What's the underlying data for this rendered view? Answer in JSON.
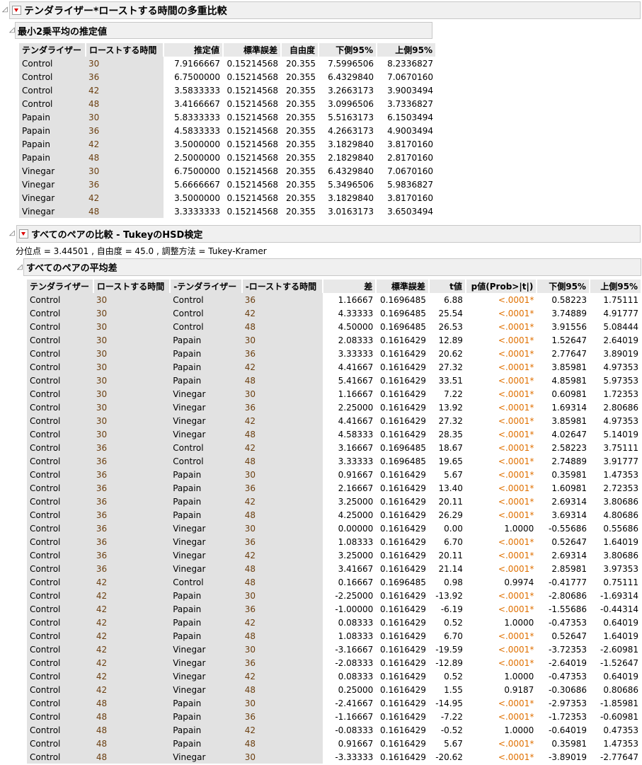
{
  "title": "テンダライザー*ローストする時間の多重比較",
  "lsmeans": {
    "title": "最小2乗平均の推定値",
    "headers": [
      "テンダライザー",
      "ローストする時間",
      "推定値",
      "標準誤差",
      "自由度",
      "下側95%",
      "上側95%"
    ],
    "rows": [
      [
        "Control",
        "30",
        "7.9166667",
        "0.15214568",
        "20.355",
        "7.5996506",
        "8.2336827"
      ],
      [
        "Control",
        "36",
        "6.7500000",
        "0.15214568",
        "20.355",
        "6.4329840",
        "7.0670160"
      ],
      [
        "Control",
        "42",
        "3.5833333",
        "0.15214568",
        "20.355",
        "3.2663173",
        "3.9003494"
      ],
      [
        "Control",
        "48",
        "3.4166667",
        "0.15214568",
        "20.355",
        "3.0996506",
        "3.7336827"
      ],
      [
        "Papain",
        "30",
        "5.8333333",
        "0.15214568",
        "20.355",
        "5.5163173",
        "6.1503494"
      ],
      [
        "Papain",
        "36",
        "4.5833333",
        "0.15214568",
        "20.355",
        "4.2663173",
        "4.9003494"
      ],
      [
        "Papain",
        "42",
        "3.5000000",
        "0.15214568",
        "20.355",
        "3.1829840",
        "3.8170160"
      ],
      [
        "Papain",
        "48",
        "2.5000000",
        "0.15214568",
        "20.355",
        "2.1829840",
        "2.8170160"
      ],
      [
        "Vinegar",
        "30",
        "6.7500000",
        "0.15214568",
        "20.355",
        "6.4329840",
        "7.0670160"
      ],
      [
        "Vinegar",
        "36",
        "5.6666667",
        "0.15214568",
        "20.355",
        "5.3496506",
        "5.9836827"
      ],
      [
        "Vinegar",
        "42",
        "3.5000000",
        "0.15214568",
        "20.355",
        "3.1829840",
        "3.8170160"
      ],
      [
        "Vinegar",
        "48",
        "3.3333333",
        "0.15214568",
        "20.355",
        "3.0163173",
        "3.6503494"
      ]
    ]
  },
  "tukey": {
    "title": "すべてのペアの比較 - TukeyのHSD検定",
    "note": "分位点 = 3.44501 , 自由度 = 45.0 , 調整方法 = Tukey-Kramer",
    "diff_title": "すべてのペアの平均差",
    "headers": [
      "テンダライザー",
      "ローストする時間",
      "-テンダライザー",
      "-ローストする時間",
      "差",
      "標準誤差",
      "t値",
      "p値(Prob>|t|)",
      "下側95%",
      "上側95%"
    ],
    "rows": [
      [
        "Control",
        "30",
        "Control",
        "36",
        "1.16667",
        "0.1696485",
        "6.88",
        "<.0001*",
        "0.58223",
        "1.75111"
      ],
      [
        "Control",
        "30",
        "Control",
        "42",
        "4.33333",
        "0.1696485",
        "25.54",
        "<.0001*",
        "3.74889",
        "4.91777"
      ],
      [
        "Control",
        "30",
        "Control",
        "48",
        "4.50000",
        "0.1696485",
        "26.53",
        "<.0001*",
        "3.91556",
        "5.08444"
      ],
      [
        "Control",
        "30",
        "Papain",
        "30",
        "2.08333",
        "0.1616429",
        "12.89",
        "<.0001*",
        "1.52647",
        "2.64019"
      ],
      [
        "Control",
        "30",
        "Papain",
        "36",
        "3.33333",
        "0.1616429",
        "20.62",
        "<.0001*",
        "2.77647",
        "3.89019"
      ],
      [
        "Control",
        "30",
        "Papain",
        "42",
        "4.41667",
        "0.1616429",
        "27.32",
        "<.0001*",
        "3.85981",
        "4.97353"
      ],
      [
        "Control",
        "30",
        "Papain",
        "48",
        "5.41667",
        "0.1616429",
        "33.51",
        "<.0001*",
        "4.85981",
        "5.97353"
      ],
      [
        "Control",
        "30",
        "Vinegar",
        "30",
        "1.16667",
        "0.1616429",
        "7.22",
        "<.0001*",
        "0.60981",
        "1.72353"
      ],
      [
        "Control",
        "30",
        "Vinegar",
        "36",
        "2.25000",
        "0.1616429",
        "13.92",
        "<.0001*",
        "1.69314",
        "2.80686"
      ],
      [
        "Control",
        "30",
        "Vinegar",
        "42",
        "4.41667",
        "0.1616429",
        "27.32",
        "<.0001*",
        "3.85981",
        "4.97353"
      ],
      [
        "Control",
        "30",
        "Vinegar",
        "48",
        "4.58333",
        "0.1616429",
        "28.35",
        "<.0001*",
        "4.02647",
        "5.14019"
      ],
      [
        "Control",
        "36",
        "Control",
        "42",
        "3.16667",
        "0.1696485",
        "18.67",
        "<.0001*",
        "2.58223",
        "3.75111"
      ],
      [
        "Control",
        "36",
        "Control",
        "48",
        "3.33333",
        "0.1696485",
        "19.65",
        "<.0001*",
        "2.74889",
        "3.91777"
      ],
      [
        "Control",
        "36",
        "Papain",
        "30",
        "0.91667",
        "0.1616429",
        "5.67",
        "<.0001*",
        "0.35981",
        "1.47353"
      ],
      [
        "Control",
        "36",
        "Papain",
        "36",
        "2.16667",
        "0.1616429",
        "13.40",
        "<.0001*",
        "1.60981",
        "2.72353"
      ],
      [
        "Control",
        "36",
        "Papain",
        "42",
        "3.25000",
        "0.1616429",
        "20.11",
        "<.0001*",
        "2.69314",
        "3.80686"
      ],
      [
        "Control",
        "36",
        "Papain",
        "48",
        "4.25000",
        "0.1616429",
        "26.29",
        "<.0001*",
        "3.69314",
        "4.80686"
      ],
      [
        "Control",
        "36",
        "Vinegar",
        "30",
        "0.00000",
        "0.1616429",
        "0.00",
        "1.0000",
        "-0.55686",
        "0.55686"
      ],
      [
        "Control",
        "36",
        "Vinegar",
        "36",
        "1.08333",
        "0.1616429",
        "6.70",
        "<.0001*",
        "0.52647",
        "1.64019"
      ],
      [
        "Control",
        "36",
        "Vinegar",
        "42",
        "3.25000",
        "0.1616429",
        "20.11",
        "<.0001*",
        "2.69314",
        "3.80686"
      ],
      [
        "Control",
        "36",
        "Vinegar",
        "48",
        "3.41667",
        "0.1616429",
        "21.14",
        "<.0001*",
        "2.85981",
        "3.97353"
      ],
      [
        "Control",
        "42",
        "Control",
        "48",
        "0.16667",
        "0.1696485",
        "0.98",
        "0.9974",
        "-0.41777",
        "0.75111"
      ],
      [
        "Control",
        "42",
        "Papain",
        "30",
        "-2.25000",
        "0.1616429",
        "-13.92",
        "<.0001*",
        "-2.80686",
        "-1.69314"
      ],
      [
        "Control",
        "42",
        "Papain",
        "36",
        "-1.00000",
        "0.1616429",
        "-6.19",
        "<.0001*",
        "-1.55686",
        "-0.44314"
      ],
      [
        "Control",
        "42",
        "Papain",
        "42",
        "0.08333",
        "0.1616429",
        "0.52",
        "1.0000",
        "-0.47353",
        "0.64019"
      ],
      [
        "Control",
        "42",
        "Papain",
        "48",
        "1.08333",
        "0.1616429",
        "6.70",
        "<.0001*",
        "0.52647",
        "1.64019"
      ],
      [
        "Control",
        "42",
        "Vinegar",
        "30",
        "-3.16667",
        "0.1616429",
        "-19.59",
        "<.0001*",
        "-3.72353",
        "-2.60981"
      ],
      [
        "Control",
        "42",
        "Vinegar",
        "36",
        "-2.08333",
        "0.1616429",
        "-12.89",
        "<.0001*",
        "-2.64019",
        "-1.52647"
      ],
      [
        "Control",
        "42",
        "Vinegar",
        "42",
        "0.08333",
        "0.1616429",
        "0.52",
        "1.0000",
        "-0.47353",
        "0.64019"
      ],
      [
        "Control",
        "42",
        "Vinegar",
        "48",
        "0.25000",
        "0.1616429",
        "1.55",
        "0.9187",
        "-0.30686",
        "0.80686"
      ],
      [
        "Control",
        "48",
        "Papain",
        "30",
        "-2.41667",
        "0.1616429",
        "-14.95",
        "<.0001*",
        "-2.97353",
        "-1.85981"
      ],
      [
        "Control",
        "48",
        "Papain",
        "36",
        "-1.16667",
        "0.1616429",
        "-7.22",
        "<.0001*",
        "-1.72353",
        "-0.60981"
      ],
      [
        "Control",
        "48",
        "Papain",
        "42",
        "-0.08333",
        "0.1616429",
        "-0.52",
        "1.0000",
        "-0.64019",
        "0.47353"
      ],
      [
        "Control",
        "48",
        "Papain",
        "48",
        "0.91667",
        "0.1616429",
        "5.67",
        "<.0001*",
        "0.35981",
        "1.47353"
      ],
      [
        "Control",
        "48",
        "Vinegar",
        "30",
        "-3.33333",
        "0.1616429",
        "-20.62",
        "<.0001*",
        "-3.89019",
        "-2.77647"
      ]
    ]
  }
}
